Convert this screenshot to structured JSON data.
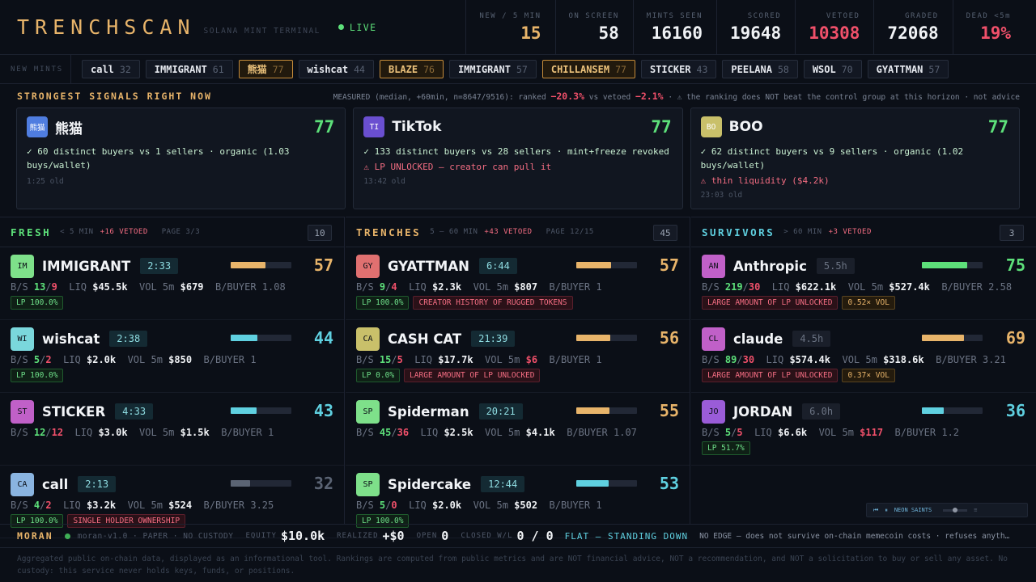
{
  "header": {
    "brand": "TRENCHSCAN",
    "subtitle": "SOLANA MINT TERMINAL",
    "live": "LIVE",
    "stats": [
      {
        "label": "NEW / 5 MIN",
        "value": "15",
        "tone": "gold"
      },
      {
        "label": "ON SCREEN",
        "value": "58",
        "tone": ""
      },
      {
        "label": "MINTS SEEN",
        "value": "16160",
        "tone": ""
      },
      {
        "label": "SCORED",
        "value": "19648",
        "tone": ""
      },
      {
        "label": "VETOED",
        "value": "10308",
        "tone": "red"
      },
      {
        "label": "GRADED",
        "value": "72068",
        "tone": ""
      },
      {
        "label": "DEAD <5m",
        "value": "19%",
        "tone": "red"
      }
    ]
  },
  "mint_strip": {
    "label": "NEW MINTS",
    "chips": [
      {
        "name": "call",
        "score": "32",
        "hot": false
      },
      {
        "name": "IMMIGRANT",
        "score": "61",
        "hot": false
      },
      {
        "name": "熊猫",
        "score": "77",
        "hot": true
      },
      {
        "name": "wishcat",
        "score": "44",
        "hot": false
      },
      {
        "name": "BLAZE",
        "score": "76",
        "hot": true
      },
      {
        "name": "IMMIGRANT",
        "score": "57",
        "hot": false
      },
      {
        "name": "CHILLANSEM",
        "score": "77",
        "hot": true
      },
      {
        "name": "STICKER",
        "score": "43",
        "hot": false
      },
      {
        "name": "PEELANA",
        "score": "58",
        "hot": false
      },
      {
        "name": "WSOL",
        "score": "70",
        "hot": false
      },
      {
        "name": "GYATTMAN",
        "score": "57",
        "hot": false
      }
    ]
  },
  "signals": {
    "title": "STRONGEST SIGNALS RIGHT NOW",
    "note_prefix": "MEASURED (median, +60min, n=8647/9516): ranked",
    "ranked": "−20.3%",
    "note_mid": "vs vetoed",
    "vetoed": "−2.1%",
    "note_suffix": "· ⚠ the ranking does NOT beat the control group at this horizon · not advice",
    "cards": [
      {
        "avatar": "熊猫",
        "avatar_color": "#4f7de0",
        "name": "熊猫",
        "score": "77",
        "good": "✓ 60 distinct buyers vs 1 sellers · organic (1.03 buys/wallet)",
        "warn": "",
        "age": "1:25 old"
      },
      {
        "avatar": "TI",
        "avatar_color": "#6a4fd0",
        "name": "TikTok",
        "score": "77",
        "good": "✓ 133 distinct buyers vs 28 sellers · mint+freeze revoked",
        "warn": "⚠ LP UNLOCKED — creator can pull it",
        "age": "13:42 old"
      },
      {
        "avatar": "BO",
        "avatar_color": "#c9c06a",
        "name": "BOO",
        "score": "77",
        "good": "✓ 62 distinct buyers vs 9 sellers · organic (1.02 buys/wallet)",
        "warn": "⚠ thin liquidity ($4.2k)",
        "age": "23:03 old"
      }
    ]
  },
  "columns": {
    "fresh": {
      "title": "FRESH",
      "sub": "< 5 MIN",
      "vetoed": "+16 VETOED",
      "page": "PAGE 3/3",
      "count": "10",
      "color": "#5de07a",
      "rows": [
        {
          "av": "IM",
          "avc": "#7ee08a",
          "name": "IMMIGRANT",
          "age": "2:33",
          "age_dim": false,
          "score": "57",
          "score_color": "#e8b46a",
          "bar": 0.57,
          "bar_color": "#e8b46a",
          "buys": "13",
          "sells": "9",
          "liq": "$45.5k",
          "vol": "$679",
          "vol_red": false,
          "bpb": "1.08",
          "tags": [
            {
              "t": "LP 100.0%",
              "k": "lp"
            }
          ]
        },
        {
          "av": "WI",
          "avc": "#7ad7dc",
          "name": "wishcat",
          "age": "2:38",
          "age_dim": false,
          "score": "44",
          "score_color": "#5fd0e0",
          "bar": 0.44,
          "bar_color": "#5fd0e0",
          "buys": "5",
          "sells": "2",
          "liq": "$2.0k",
          "vol": "$850",
          "vol_red": false,
          "bpb": "1",
          "tags": [
            {
              "t": "LP 100.0%",
              "k": "lp"
            }
          ]
        },
        {
          "av": "ST",
          "avc": "#c060c8",
          "name": "STICKER",
          "age": "4:33",
          "age_dim": false,
          "score": "43",
          "score_color": "#5fd0e0",
          "bar": 0.43,
          "bar_color": "#5fd0e0",
          "buys": "12",
          "sells": "12",
          "liq": "$3.0k",
          "vol": "$1.5k",
          "vol_red": false,
          "bpb": "1",
          "tags": []
        },
        {
          "av": "CA",
          "avc": "#8ab4e0",
          "name": "call",
          "age": "2:13",
          "age_dim": false,
          "score": "32",
          "score_color": "#5b6474",
          "bar": 0.32,
          "bar_color": "#5b6474",
          "buys": "4",
          "sells": "2",
          "liq": "$3.2k",
          "vol": "$524",
          "vol_red": false,
          "bpb": "3.25",
          "tags": [
            {
              "t": "LP 100.0%",
              "k": "lp"
            },
            {
              "t": "SINGLE HOLDER OWNERSHIP",
              "k": "bad"
            }
          ]
        }
      ]
    },
    "trenches": {
      "title": "TRENCHES",
      "sub": "5 – 60 MIN",
      "vetoed": "+43 VETOED",
      "page": "PAGE 12/15",
      "count": "45",
      "color": "#e8b46a",
      "rows": [
        {
          "av": "GY",
          "avc": "#e07070",
          "name": "GYATTMAN",
          "age": "6:44",
          "age_dim": false,
          "score": "57",
          "score_color": "#e8b46a",
          "bar": 0.57,
          "bar_color": "#e8b46a",
          "buys": "9",
          "sells": "4",
          "liq": "$2.3k",
          "vol": "$807",
          "vol_red": false,
          "bpb": "1",
          "tags": [
            {
              "t": "LP 100.0%",
              "k": "lp"
            },
            {
              "t": "CREATOR HISTORY OF RUGGED TOKENS",
              "k": "bad"
            }
          ]
        },
        {
          "av": "CA",
          "avc": "#c9c06a",
          "name": "CASH CAT",
          "age": "21:39",
          "age_dim": false,
          "score": "56",
          "score_color": "#e8b46a",
          "bar": 0.56,
          "bar_color": "#e8b46a",
          "buys": "15",
          "sells": "5",
          "liq": "$17.7k",
          "vol": "$6",
          "vol_red": true,
          "bpb": "1",
          "tags": [
            {
              "t": "LP 0.0%",
              "k": "lp"
            },
            {
              "t": "LARGE AMOUNT OF LP UNLOCKED",
              "k": "bad"
            }
          ]
        },
        {
          "av": "SP",
          "avc": "#7ee08a",
          "name": "Spiderman",
          "age": "20:21",
          "age_dim": false,
          "score": "55",
          "score_color": "#e8b46a",
          "bar": 0.55,
          "bar_color": "#e8b46a",
          "buys": "45",
          "sells": "36",
          "liq": "$2.5k",
          "vol": "$4.1k",
          "vol_red": false,
          "bpb": "1.07",
          "tags": []
        },
        {
          "av": "SP",
          "avc": "#7ee08a",
          "name": "Spidercake",
          "age": "12:44",
          "age_dim": false,
          "score": "53",
          "score_color": "#5fd0e0",
          "bar": 0.53,
          "bar_color": "#5fd0e0",
          "buys": "5",
          "sells": "0",
          "liq": "$2.0k",
          "vol": "$502",
          "vol_red": false,
          "bpb": "1",
          "tags": [
            {
              "t": "LP 100.0%",
              "k": "lp"
            }
          ]
        }
      ]
    },
    "survivors": {
      "title": "SURVIVORS",
      "sub": "> 60 MIN",
      "vetoed": "+3 VETOED",
      "page": "",
      "count": "3",
      "color": "#5fd0e0",
      "rows": [
        {
          "av": "AN",
          "avc": "#c060c8",
          "name": "Anthropic",
          "age": "5.5h",
          "age_dim": true,
          "score": "75",
          "score_color": "#5de07a",
          "bar": 0.75,
          "bar_color": "#5de07a",
          "buys": "219",
          "sells": "30",
          "liq": "$622.1k",
          "vol": "$527.4k",
          "vol_red": false,
          "bpb": "2.58",
          "tags": [
            {
              "t": "LARGE AMOUNT OF LP UNLOCKED",
              "k": "bad"
            },
            {
              "t": "0.52× VOL",
              "k": "warnt"
            }
          ]
        },
        {
          "av": "CL",
          "avc": "#c060c8",
          "name": "claude",
          "age": "4.5h",
          "age_dim": true,
          "score": "69",
          "score_color": "#e8b46a",
          "bar": 0.69,
          "bar_color": "#e8b46a",
          "buys": "89",
          "sells": "30",
          "liq": "$574.4k",
          "vol": "$318.6k",
          "vol_red": false,
          "bpb": "3.21",
          "tags": [
            {
              "t": "LARGE AMOUNT OF LP UNLOCKED",
              "k": "bad"
            },
            {
              "t": "0.37× VOL",
              "k": "warnt"
            }
          ]
        },
        {
          "av": "JO",
          "avc": "#9a5cd8",
          "name": "JORDAN",
          "age": "6.0h",
          "age_dim": true,
          "score": "36",
          "score_color": "#5fd0e0",
          "bar": 0.36,
          "bar_color": "#5fd0e0",
          "buys": "5",
          "sells": "5",
          "liq": "$6.6k",
          "vol": "$117",
          "vol_red": true,
          "bpb": "1.2",
          "tags": [
            {
              "t": "LP 51.7%",
              "k": "lp"
            }
          ]
        }
      ]
    }
  },
  "row_labels": {
    "bs": "B/S",
    "liq": "LIQ",
    "vol": "VOL 5m",
    "bpb": "B/BUYER"
  },
  "player": {
    "label": "NEON SAINTS"
  },
  "bottom": {
    "brand": "MORAN",
    "engine": "moran-v1.0 · PAPER · NO CUSTODY",
    "equity_label": "EQUITY",
    "equity": "$10.0k",
    "realized_label": "REALIZED",
    "realized": "+$0",
    "open_label": "OPEN",
    "open": "0",
    "closed_label": "CLOSED W/L",
    "closed": "0 / 0",
    "status": "FLAT — STANDING DOWN",
    "noedge": "NO EDGE — does not survive on-chain memecoin costs · refuses anyth…"
  },
  "disclaimer": "Aggregated public on-chain data, displayed as an informational tool. Rankings are computed from public metrics and are NOT financial advice, NOT a recommendation, and NOT a solicitation to buy or sell any asset. No custody: this service never holds keys, funds, or positions."
}
